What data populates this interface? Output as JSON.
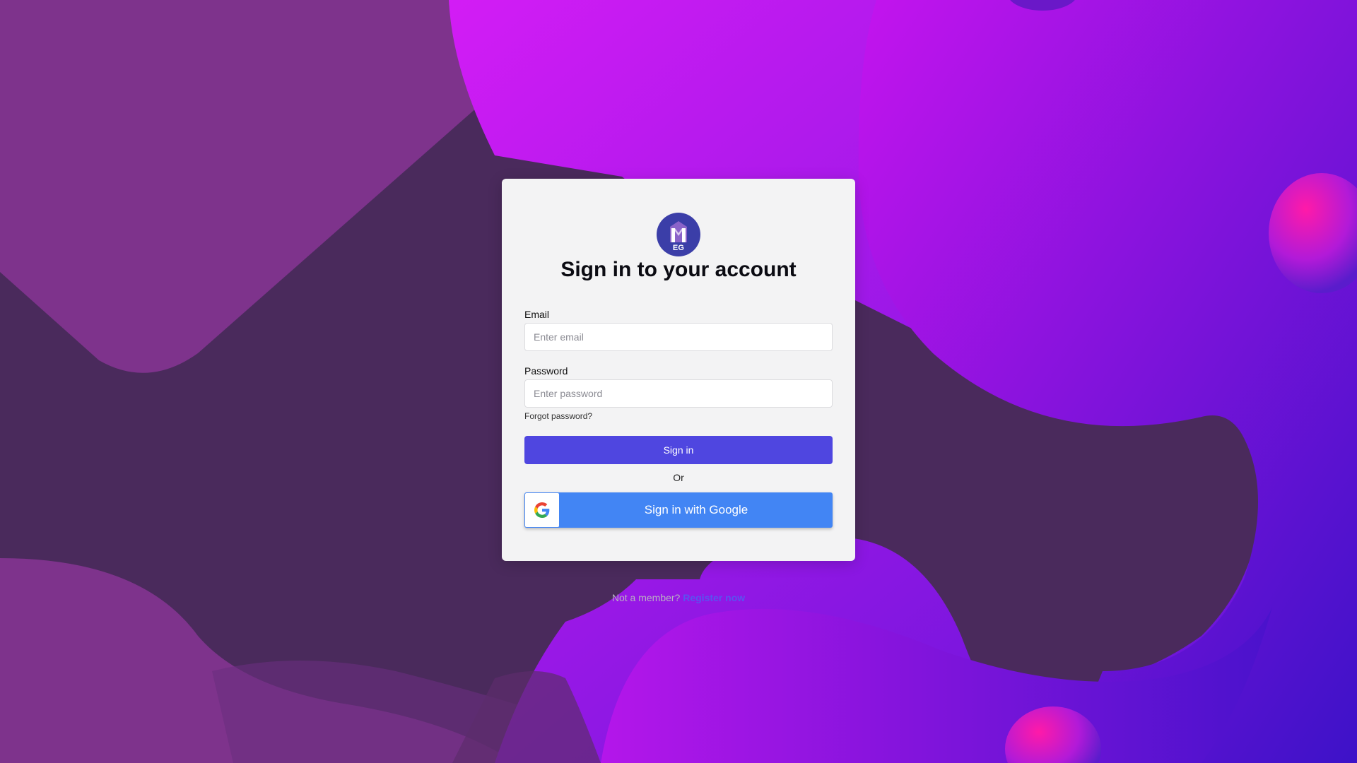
{
  "colors": {
    "background": "#4a2a5c",
    "card": "#f3f3f4",
    "primary_button": "#4f46e0",
    "google_button": "#4285f4",
    "link": "#5b52f0",
    "logo_circle": "#3b3ea8"
  },
  "logo": {
    "text": "EG",
    "icon": "building-columns-icon"
  },
  "form": {
    "title": "Sign in to your account",
    "email_label": "Email",
    "email_placeholder": "Enter email",
    "email_value": "",
    "password_label": "Password",
    "password_placeholder": "Enter password",
    "password_value": "",
    "forgot_label": "Forgot password?",
    "signin_label": "Sign in",
    "or_text": "Or",
    "google_label": "Sign in with Google",
    "google_icon": "google-g-icon"
  },
  "footer": {
    "prompt": "Not a member?",
    "register_label": "Register now"
  }
}
